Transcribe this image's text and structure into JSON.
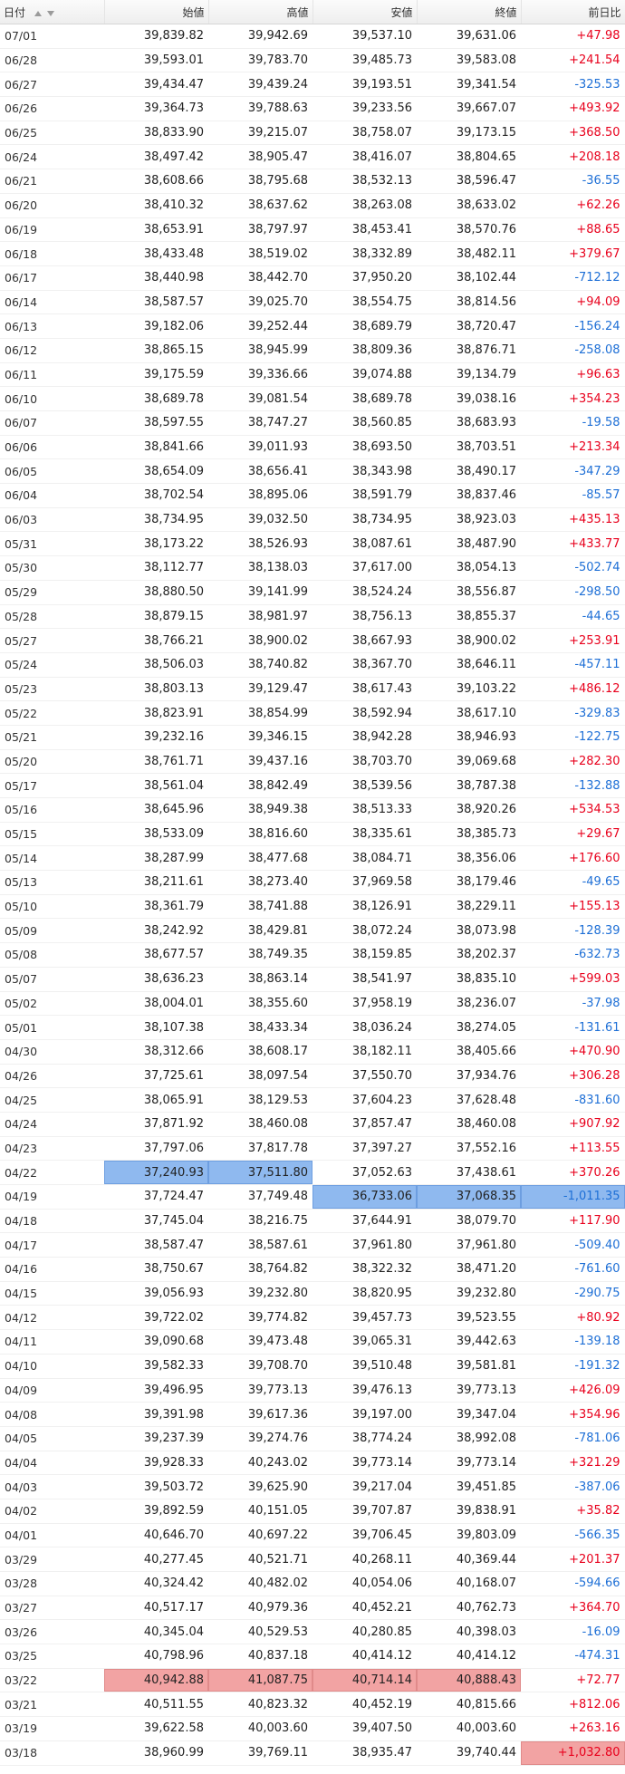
{
  "columns": [
    "日付",
    "始値",
    "高値",
    "安値",
    "終値",
    "前日比"
  ],
  "colors": {
    "up": "#e8001c",
    "down": "#1e6fd6",
    "highlight_blue": "#8fb9ef",
    "highlight_red": "#f2a3a3"
  },
  "rows": [
    {
      "date": "07/01",
      "open": "39,839.82",
      "high": "39,942.69",
      "low": "39,537.10",
      "close": "39,631.06",
      "change": "+47.98"
    },
    {
      "date": "06/28",
      "open": "39,593.01",
      "high": "39,783.70",
      "low": "39,485.73",
      "close": "39,583.08",
      "change": "+241.54"
    },
    {
      "date": "06/27",
      "open": "39,434.47",
      "high": "39,439.24",
      "low": "39,193.51",
      "close": "39,341.54",
      "change": "-325.53"
    },
    {
      "date": "06/26",
      "open": "39,364.73",
      "high": "39,788.63",
      "low": "39,233.56",
      "close": "39,667.07",
      "change": "+493.92"
    },
    {
      "date": "06/25",
      "open": "38,833.90",
      "high": "39,215.07",
      "low": "38,758.07",
      "close": "39,173.15",
      "change": "+368.50"
    },
    {
      "date": "06/24",
      "open": "38,497.42",
      "high": "38,905.47",
      "low": "38,416.07",
      "close": "38,804.65",
      "change": "+208.18"
    },
    {
      "date": "06/21",
      "open": "38,608.66",
      "high": "38,795.68",
      "low": "38,532.13",
      "close": "38,596.47",
      "change": "-36.55"
    },
    {
      "date": "06/20",
      "open": "38,410.32",
      "high": "38,637.62",
      "low": "38,263.08",
      "close": "38,633.02",
      "change": "+62.26"
    },
    {
      "date": "06/19",
      "open": "38,653.91",
      "high": "38,797.97",
      "low": "38,453.41",
      "close": "38,570.76",
      "change": "+88.65"
    },
    {
      "date": "06/18",
      "open": "38,433.48",
      "high": "38,519.02",
      "low": "38,332.89",
      "close": "38,482.11",
      "change": "+379.67"
    },
    {
      "date": "06/17",
      "open": "38,440.98",
      "high": "38,442.70",
      "low": "37,950.20",
      "close": "38,102.44",
      "change": "-712.12"
    },
    {
      "date": "06/14",
      "open": "38,587.57",
      "high": "39,025.70",
      "low": "38,554.75",
      "close": "38,814.56",
      "change": "+94.09"
    },
    {
      "date": "06/13",
      "open": "39,182.06",
      "high": "39,252.44",
      "low": "38,689.79",
      "close": "38,720.47",
      "change": "-156.24"
    },
    {
      "date": "06/12",
      "open": "38,865.15",
      "high": "38,945.99",
      "low": "38,809.36",
      "close": "38,876.71",
      "change": "-258.08"
    },
    {
      "date": "06/11",
      "open": "39,175.59",
      "high": "39,336.66",
      "low": "39,074.88",
      "close": "39,134.79",
      "change": "+96.63"
    },
    {
      "date": "06/10",
      "open": "38,689.78",
      "high": "39,081.54",
      "low": "38,689.78",
      "close": "39,038.16",
      "change": "+354.23"
    },
    {
      "date": "06/07",
      "open": "38,597.55",
      "high": "38,747.27",
      "low": "38,560.85",
      "close": "38,683.93",
      "change": "-19.58"
    },
    {
      "date": "06/06",
      "open": "38,841.66",
      "high": "39,011.93",
      "low": "38,693.50",
      "close": "38,703.51",
      "change": "+213.34"
    },
    {
      "date": "06/05",
      "open": "38,654.09",
      "high": "38,656.41",
      "low": "38,343.98",
      "close": "38,490.17",
      "change": "-347.29"
    },
    {
      "date": "06/04",
      "open": "38,702.54",
      "high": "38,895.06",
      "low": "38,591.79",
      "close": "38,837.46",
      "change": "-85.57"
    },
    {
      "date": "06/03",
      "open": "38,734.95",
      "high": "39,032.50",
      "low": "38,734.95",
      "close": "38,923.03",
      "change": "+435.13"
    },
    {
      "date": "05/31",
      "open": "38,173.22",
      "high": "38,526.93",
      "low": "38,087.61",
      "close": "38,487.90",
      "change": "+433.77"
    },
    {
      "date": "05/30",
      "open": "38,112.77",
      "high": "38,138.03",
      "low": "37,617.00",
      "close": "38,054.13",
      "change": "-502.74"
    },
    {
      "date": "05/29",
      "open": "38,880.50",
      "high": "39,141.99",
      "low": "38,524.24",
      "close": "38,556.87",
      "change": "-298.50"
    },
    {
      "date": "05/28",
      "open": "38,879.15",
      "high": "38,981.97",
      "low": "38,756.13",
      "close": "38,855.37",
      "change": "-44.65"
    },
    {
      "date": "05/27",
      "open": "38,766.21",
      "high": "38,900.02",
      "low": "38,667.93",
      "close": "38,900.02",
      "change": "+253.91"
    },
    {
      "date": "05/24",
      "open": "38,506.03",
      "high": "38,740.82",
      "low": "38,367.70",
      "close": "38,646.11",
      "change": "-457.11"
    },
    {
      "date": "05/23",
      "open": "38,803.13",
      "high": "39,129.47",
      "low": "38,617.43",
      "close": "39,103.22",
      "change": "+486.12"
    },
    {
      "date": "05/22",
      "open": "38,823.91",
      "high": "38,854.99",
      "low": "38,592.94",
      "close": "38,617.10",
      "change": "-329.83"
    },
    {
      "date": "05/21",
      "open": "39,232.16",
      "high": "39,346.15",
      "low": "38,942.28",
      "close": "38,946.93",
      "change": "-122.75"
    },
    {
      "date": "05/20",
      "open": "38,761.71",
      "high": "39,437.16",
      "low": "38,703.70",
      "close": "39,069.68",
      "change": "+282.30"
    },
    {
      "date": "05/17",
      "open": "38,561.04",
      "high": "38,842.49",
      "low": "38,539.56",
      "close": "38,787.38",
      "change": "-132.88"
    },
    {
      "date": "05/16",
      "open": "38,645.96",
      "high": "38,949.38",
      "low": "38,513.33",
      "close": "38,920.26",
      "change": "+534.53"
    },
    {
      "date": "05/15",
      "open": "38,533.09",
      "high": "38,816.60",
      "low": "38,335.61",
      "close": "38,385.73",
      "change": "+29.67"
    },
    {
      "date": "05/14",
      "open": "38,287.99",
      "high": "38,477.68",
      "low": "38,084.71",
      "close": "38,356.06",
      "change": "+176.60"
    },
    {
      "date": "05/13",
      "open": "38,211.61",
      "high": "38,273.40",
      "low": "37,969.58",
      "close": "38,179.46",
      "change": "-49.65"
    },
    {
      "date": "05/10",
      "open": "38,361.79",
      "high": "38,741.88",
      "low": "38,126.91",
      "close": "38,229.11",
      "change": "+155.13"
    },
    {
      "date": "05/09",
      "open": "38,242.92",
      "high": "38,429.81",
      "low": "38,072.24",
      "close": "38,073.98",
      "change": "-128.39"
    },
    {
      "date": "05/08",
      "open": "38,677.57",
      "high": "38,749.35",
      "low": "38,159.85",
      "close": "38,202.37",
      "change": "-632.73"
    },
    {
      "date": "05/07",
      "open": "38,636.23",
      "high": "38,863.14",
      "low": "38,541.97",
      "close": "38,835.10",
      "change": "+599.03"
    },
    {
      "date": "05/02",
      "open": "38,004.01",
      "high": "38,355.60",
      "low": "37,958.19",
      "close": "38,236.07",
      "change": "-37.98"
    },
    {
      "date": "05/01",
      "open": "38,107.38",
      "high": "38,433.34",
      "low": "38,036.24",
      "close": "38,274.05",
      "change": "-131.61"
    },
    {
      "date": "04/30",
      "open": "38,312.66",
      "high": "38,608.17",
      "low": "38,182.11",
      "close": "38,405.66",
      "change": "+470.90"
    },
    {
      "date": "04/26",
      "open": "37,725.61",
      "high": "38,097.54",
      "low": "37,550.70",
      "close": "37,934.76",
      "change": "+306.28"
    },
    {
      "date": "04/25",
      "open": "38,065.91",
      "high": "38,129.53",
      "low": "37,604.23",
      "close": "37,628.48",
      "change": "-831.60"
    },
    {
      "date": "04/24",
      "open": "37,871.92",
      "high": "38,460.08",
      "low": "37,857.47",
      "close": "38,460.08",
      "change": "+907.92"
    },
    {
      "date": "04/23",
      "open": "37,797.06",
      "high": "37,817.78",
      "low": "37,397.27",
      "close": "37,552.16",
      "change": "+113.55"
    },
    {
      "date": "04/22",
      "open": "37,240.93",
      "high": "37,511.80",
      "low": "37,052.63",
      "close": "37,438.61",
      "change": "+370.26",
      "hl": [
        "open",
        "high"
      ],
      "hlc": "blue"
    },
    {
      "date": "04/19",
      "open": "37,724.47",
      "high": "37,749.48",
      "low": "36,733.06",
      "close": "37,068.35",
      "change": "-1,011.35",
      "hl": [
        "low",
        "close",
        "change"
      ],
      "hlc": "blue"
    },
    {
      "date": "04/18",
      "open": "37,745.04",
      "high": "38,216.75",
      "low": "37,644.91",
      "close": "38,079.70",
      "change": "+117.90"
    },
    {
      "date": "04/17",
      "open": "38,587.47",
      "high": "38,587.61",
      "low": "37,961.80",
      "close": "37,961.80",
      "change": "-509.40"
    },
    {
      "date": "04/16",
      "open": "38,750.67",
      "high": "38,764.82",
      "low": "38,322.32",
      "close": "38,471.20",
      "change": "-761.60"
    },
    {
      "date": "04/15",
      "open": "39,056.93",
      "high": "39,232.80",
      "low": "38,820.95",
      "close": "39,232.80",
      "change": "-290.75"
    },
    {
      "date": "04/12",
      "open": "39,722.02",
      "high": "39,774.82",
      "low": "39,457.73",
      "close": "39,523.55",
      "change": "+80.92"
    },
    {
      "date": "04/11",
      "open": "39,090.68",
      "high": "39,473.48",
      "low": "39,065.31",
      "close": "39,442.63",
      "change": "-139.18"
    },
    {
      "date": "04/10",
      "open": "39,582.33",
      "high": "39,708.70",
      "low": "39,510.48",
      "close": "39,581.81",
      "change": "-191.32"
    },
    {
      "date": "04/09",
      "open": "39,496.95",
      "high": "39,773.13",
      "low": "39,476.13",
      "close": "39,773.13",
      "change": "+426.09"
    },
    {
      "date": "04/08",
      "open": "39,391.98",
      "high": "39,617.36",
      "low": "39,197.00",
      "close": "39,347.04",
      "change": "+354.96"
    },
    {
      "date": "04/05",
      "open": "39,237.39",
      "high": "39,274.76",
      "low": "38,774.24",
      "close": "38,992.08",
      "change": "-781.06"
    },
    {
      "date": "04/04",
      "open": "39,928.33",
      "high": "40,243.02",
      "low": "39,773.14",
      "close": "39,773.14",
      "change": "+321.29"
    },
    {
      "date": "04/03",
      "open": "39,503.72",
      "high": "39,625.90",
      "low": "39,217.04",
      "close": "39,451.85",
      "change": "-387.06"
    },
    {
      "date": "04/02",
      "open": "39,892.59",
      "high": "40,151.05",
      "low": "39,707.87",
      "close": "39,838.91",
      "change": "+35.82"
    },
    {
      "date": "04/01",
      "open": "40,646.70",
      "high": "40,697.22",
      "low": "39,706.45",
      "close": "39,803.09",
      "change": "-566.35"
    },
    {
      "date": "03/29",
      "open": "40,277.45",
      "high": "40,521.71",
      "low": "40,268.11",
      "close": "40,369.44",
      "change": "+201.37"
    },
    {
      "date": "03/28",
      "open": "40,324.42",
      "high": "40,482.02",
      "low": "40,054.06",
      "close": "40,168.07",
      "change": "-594.66"
    },
    {
      "date": "03/27",
      "open": "40,517.17",
      "high": "40,979.36",
      "low": "40,452.21",
      "close": "40,762.73",
      "change": "+364.70"
    },
    {
      "date": "03/26",
      "open": "40,345.04",
      "high": "40,529.53",
      "low": "40,280.85",
      "close": "40,398.03",
      "change": "-16.09"
    },
    {
      "date": "03/25",
      "open": "40,798.96",
      "high": "40,837.18",
      "low": "40,414.12",
      "close": "40,414.12",
      "change": "-474.31"
    },
    {
      "date": "03/22",
      "open": "40,942.88",
      "high": "41,087.75",
      "low": "40,714.14",
      "close": "40,888.43",
      "change": "+72.77",
      "hl": [
        "open",
        "high",
        "low",
        "close"
      ],
      "hlc": "red"
    },
    {
      "date": "03/21",
      "open": "40,511.55",
      "high": "40,823.32",
      "low": "40,452.19",
      "close": "40,815.66",
      "change": "+812.06"
    },
    {
      "date": "03/19",
      "open": "39,622.58",
      "high": "40,003.60",
      "low": "39,407.50",
      "close": "40,003.60",
      "change": "+263.16"
    },
    {
      "date": "03/18",
      "open": "38,960.99",
      "high": "39,769.11",
      "low": "38,935.47",
      "close": "39,740.44",
      "change": "+1,032.80",
      "hl": [
        "change"
      ],
      "hlc": "red"
    }
  ]
}
